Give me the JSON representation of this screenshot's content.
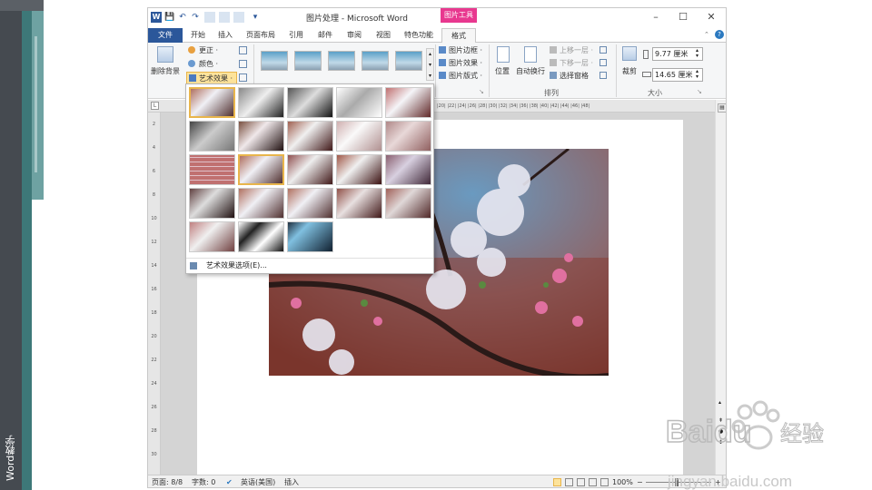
{
  "caption": "Word教学",
  "window": {
    "title": "图片处理 - Microsoft Word",
    "context_group": "图片工具",
    "word_icon": "W"
  },
  "qat": {
    "save": "💾",
    "undo": "↶",
    "redo": "↷",
    "customize": "▾"
  },
  "window_buttons": {
    "minimize": "–",
    "restore": "☐",
    "close": "✕"
  },
  "tabs": [
    "文件",
    "开始",
    "插入",
    "页面布局",
    "引用",
    "邮件",
    "审阅",
    "视图",
    "特色功能",
    "格式"
  ],
  "ribbon": {
    "adjust": {
      "remove_bg": "删除背景",
      "corrections": "更正 ·",
      "color": "颜色 ·",
      "artistic": "艺术效果 ·"
    },
    "picture_styles": {
      "border": "图片边框 ·",
      "effects": "图片效果 ·",
      "layout": "图片版式 ·"
    },
    "arrange": {
      "position": "位置",
      "wrap_text": "自动换行",
      "bring_forward": "上移一层 ·",
      "send_backward": "下移一层 ·",
      "selection_pane": "选择窗格",
      "label": "排列"
    },
    "size": {
      "crop": "裁剪",
      "height": "9.77 厘米",
      "width": "14.65 厘米",
      "label": "大小"
    }
  },
  "artistic_menu": {
    "option": "艺术效果选项(E)...",
    "selected_index": 0,
    "hover_index": 11,
    "effects_count": 23
  },
  "ruler": {
    "marks": "|20| |22| |24| |26| |28| |30| |32| |34| |36| |38| |40| |42| |44| |46| |48|",
    "vmarks": [
      "2",
      "4",
      "6",
      "8",
      "10",
      "12",
      "14",
      "16",
      "18",
      "20",
      "22",
      "24",
      "26",
      "28",
      "30"
    ]
  },
  "statusbar": {
    "page": "页面: 8/8",
    "words": "字数: 0",
    "language": "英语(美国)",
    "mode": "插入",
    "zoom": "100%",
    "zoom_minus": "−",
    "zoom_plus": "+"
  },
  "watermark": {
    "brand": "Baidu",
    "brand_cn": "经验",
    "url": "jingyan.baidu.com"
  },
  "colors": {
    "file_tab": "#2b579a",
    "context_tab": "#e8388f",
    "teal": "#3d7878",
    "selected_thumb": "#e8b54c"
  }
}
